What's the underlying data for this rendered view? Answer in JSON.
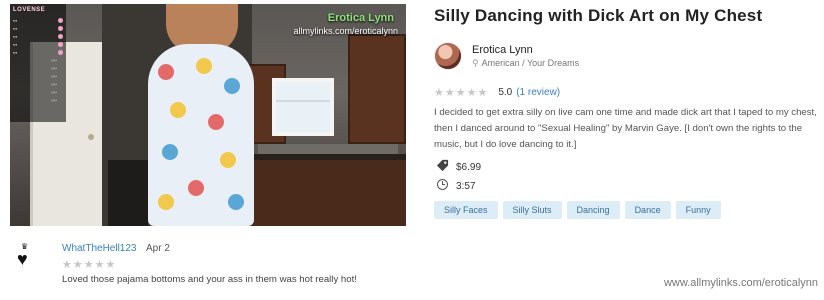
{
  "video": {
    "watermark_name": "Erotica Lynn",
    "watermark_url": "allmylinks.com/eroticalynn",
    "overlay_logo": "LOVENSE"
  },
  "listing": {
    "title": "Silly Dancing with Dick Art on My Chest",
    "creator_name": "Erotica Lynn",
    "creator_location": "American / Your Dreams",
    "rating_score": "5.0",
    "rating_reviews": "(1 review)",
    "description": "I decided to get extra silly on live cam one time and made dick art that I taped to my chest, then I danced around to \"Sexual Healing\" by Marvin Gaye. [I don't own the rights to the music, but I do love dancing to it.]",
    "price": "$6.99",
    "duration": "3:57",
    "tags": [
      "Silly Faces",
      "Silly Sluts",
      "Dancing",
      "Dance",
      "Funny"
    ]
  },
  "comment": {
    "username": "WhatTheHell123",
    "date": "Apr 2",
    "text": "Loved those pajama bottoms and your ass in them was hot really hot!"
  },
  "footer": {
    "url": "www.allmylinks.com/eroticalynn"
  },
  "colors": {
    "link": "#3c7fc0",
    "tag_bg": "#dcedf8",
    "star_empty": "#c7c7c7"
  }
}
